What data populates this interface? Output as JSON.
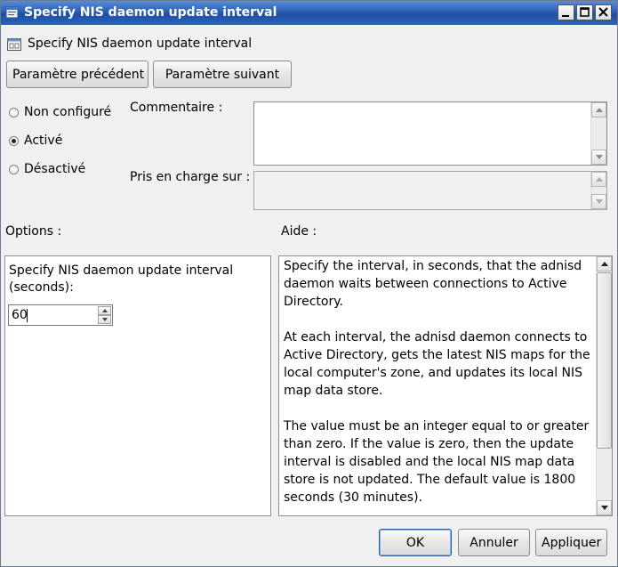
{
  "window": {
    "title": "Specify NIS daemon update interval"
  },
  "header": {
    "title": "Specify NIS daemon update interval",
    "icon": "policy-setting-icon"
  },
  "nav": {
    "previous_label": "Paramètre précédent",
    "next_label": "Paramètre suivant"
  },
  "state": {
    "options": [
      "Non configuré",
      "Activé",
      "Désactivé"
    ],
    "selected": "Activé"
  },
  "comment": {
    "label": "Commentaire :",
    "value": ""
  },
  "supported": {
    "label": "Pris en charge sur :",
    "value": ""
  },
  "options_panel": {
    "label": "Options :",
    "field_label": "Specify NIS daemon update interval (seconds):",
    "field_value": "60"
  },
  "help": {
    "label": "Aide :",
    "paragraphs": [
      "Specify the interval, in seconds, that the adnisd daemon waits between connections to Active Directory.",
      "At each interval, the adnisd daemon connects to Active Directory, gets the latest NIS maps for the local computer's zone, and updates its local NIS map data store.",
      "The value must be an integer equal to or greater than zero. If the value is zero, then the update interval is disabled and the local NIS map data store is not updated. The default value is 1800 seconds (30 minutes)."
    ],
    "scroll_position": 0.0
  },
  "footer": {
    "ok_label": "OK",
    "cancel_label": "Annuler",
    "apply_label": "Appliquer"
  },
  "colors": {
    "titlebar": "#2a5fb6",
    "background": "#f0f0f0"
  }
}
